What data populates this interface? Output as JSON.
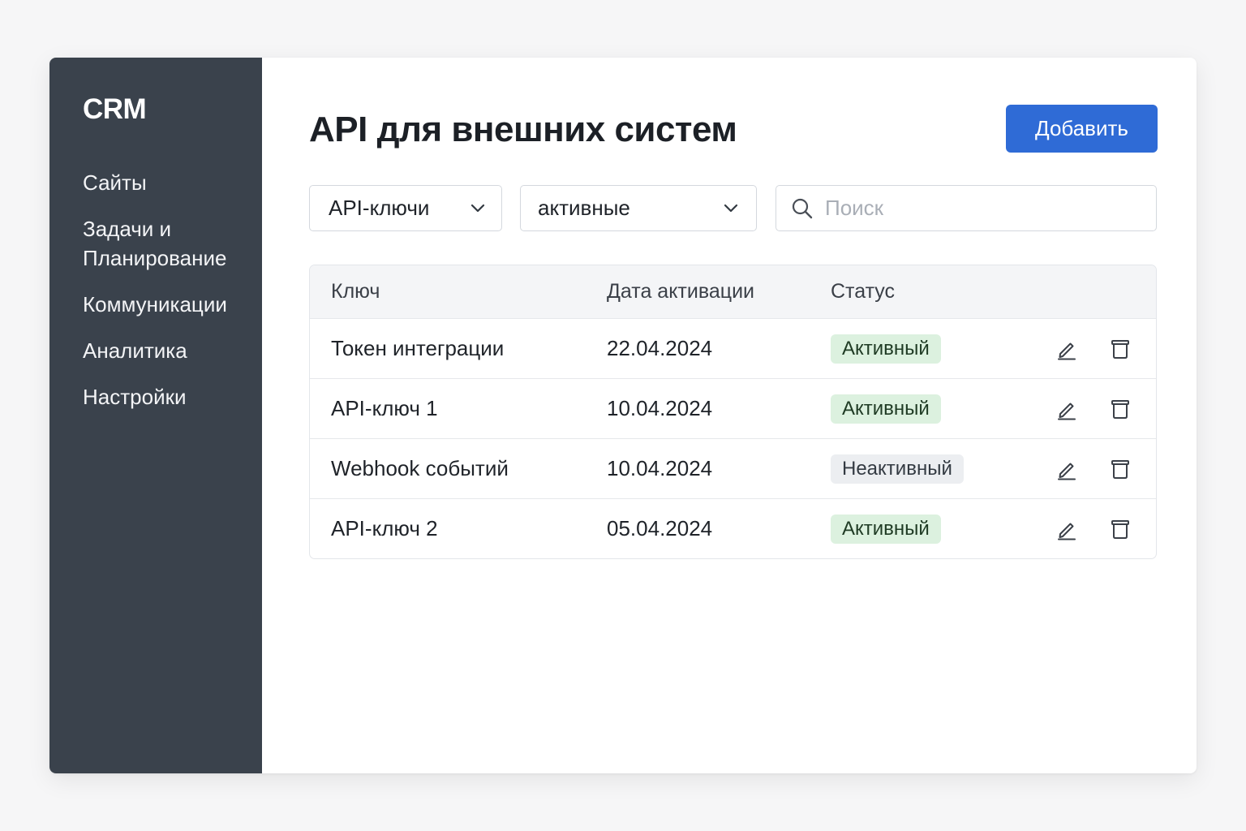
{
  "sidebar": {
    "brand": "CRM",
    "items": [
      {
        "label": "Сайты"
      },
      {
        "label": "Задачи и\nПланирование"
      },
      {
        "label": "Коммуникации"
      },
      {
        "label": "Аналитика"
      },
      {
        "label": "Настройки"
      }
    ]
  },
  "header": {
    "title": "API для внешних систем",
    "add_label": "Добавить"
  },
  "filters": {
    "type_value": "API-ключи",
    "status_value": "активные",
    "search_placeholder": "Поиск",
    "search_value": ""
  },
  "table": {
    "columns": [
      "Ключ",
      "Дата активации",
      "Статус"
    ],
    "rows": [
      {
        "key": "Токен интеграции",
        "date": "22.04.2024",
        "status": "Активный",
        "state": "active"
      },
      {
        "key": "API-ключ 1",
        "date": "10.04.2024",
        "status": "Активный",
        "state": "active"
      },
      {
        "key": "Webhook событий",
        "date": "10.04.2024",
        "status": "Неактивный",
        "state": "inactive"
      },
      {
        "key": "API-ключ 2",
        "date": "05.04.2024",
        "status": "Активный",
        "state": "active"
      }
    ]
  },
  "icons": {
    "dropdown": "chevron-down-icon",
    "search": "search-icon",
    "edit": "pencil-icon",
    "delete": "trash-icon"
  },
  "colors": {
    "sidebar_bg": "#3a424c",
    "accent": "#2f6bd6",
    "badge_active_bg": "#dcf1df",
    "badge_inactive_bg": "#eceef1"
  }
}
